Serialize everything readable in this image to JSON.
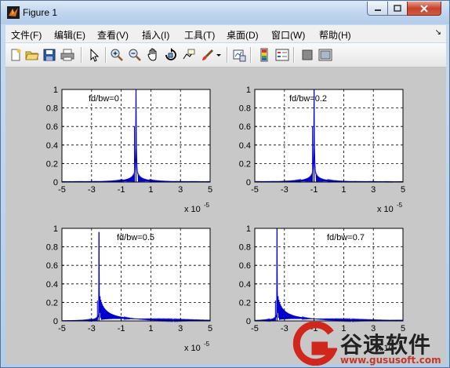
{
  "window": {
    "title": "Figure 1",
    "accent": "#3a6ea5"
  },
  "menus": [
    "文件(F)",
    "编辑(E)",
    "查看(V)",
    "插入(I)",
    "工具(T)",
    "桌面(D)",
    "窗口(W)",
    "帮助(H)"
  ],
  "toolbar": {
    "icons": [
      "new-figure-icon",
      "open-file-icon",
      "save-icon",
      "print-icon",
      "pointer-icon",
      "zoom-in-icon",
      "zoom-out-icon",
      "pan-icon",
      "rotate-3d-icon",
      "data-cursor-icon",
      "brush-icon",
      "link-plot-icon",
      "colorbar-icon",
      "legend-icon",
      "hide-plot-tools-icon",
      "show-plot-tools-icon"
    ]
  },
  "chart_data": [
    {
      "type": "line",
      "title": "",
      "annotation": "fd/bw=0",
      "xlim": [
        -5,
        5
      ],
      "ylim": [
        0,
        1
      ],
      "xticks": [
        "-5",
        "-3",
        "-1",
        "1",
        "3",
        "5"
      ],
      "yticks": [
        "0",
        "0.2",
        "0.4",
        "0.6",
        "0.8",
        "1"
      ],
      "x_exponent": "x 10",
      "x_exponent_power": "-5",
      "grid": true,
      "series": [
        {
          "color": "#0000cc",
          "peak_x": 0,
          "peak_y": 1.0,
          "side_lobe_y": 0.6
        }
      ]
    },
    {
      "type": "line",
      "title": "",
      "annotation": "fd/bw=0.2",
      "xlim": [
        -5,
        5
      ],
      "ylim": [
        0,
        1
      ],
      "xticks": [
        "-5",
        "-3",
        "-1",
        "1",
        "3",
        "5"
      ],
      "yticks": [
        "0",
        "0.2",
        "0.4",
        "0.6",
        "0.8",
        "1"
      ],
      "x_exponent": "x 10",
      "x_exponent_power": "-5",
      "grid": true,
      "series": [
        {
          "color": "#0000cc",
          "peak_x": -1.0,
          "peak_y": 1.0,
          "side_lobe_y": 0.6
        }
      ]
    },
    {
      "type": "line",
      "title": "",
      "annotation": "fd/bw=0.5",
      "xlim": [
        -5,
        5
      ],
      "ylim": [
        0,
        1
      ],
      "xticks": [
        "-5",
        "-3",
        "-1",
        "1",
        "3",
        "5"
      ],
      "yticks": [
        "0",
        "0.2",
        "0.4",
        "0.6",
        "0.8",
        "1"
      ],
      "x_exponent": "x 10",
      "x_exponent_power": "-5",
      "grid": true,
      "series": [
        {
          "color": "#0000cc",
          "peak_x": -2.5,
          "peak_y": 0.96,
          "side_lobe_y": 0.22
        }
      ]
    },
    {
      "type": "line",
      "title": "",
      "annotation": "fd/bw=0.7",
      "xlim": [
        -5,
        5
      ],
      "ylim": [
        0,
        1
      ],
      "xticks": [
        "-5",
        "-3",
        "-1",
        "1",
        "3",
        "5"
      ],
      "yticks": [
        "0",
        "0.2",
        "0.4",
        "0.6",
        "0.8",
        "1"
      ],
      "x_exponent": "x 10",
      "x_exponent_power": "-5",
      "grid": true,
      "series": [
        {
          "color": "#0000cc",
          "peak_x": -3.5,
          "peak_y": 1.0,
          "side_lobe_y": 0.22
        }
      ]
    }
  ],
  "watermark": {
    "text": "谷速软件",
    "url": "www.gususoft.com"
  }
}
